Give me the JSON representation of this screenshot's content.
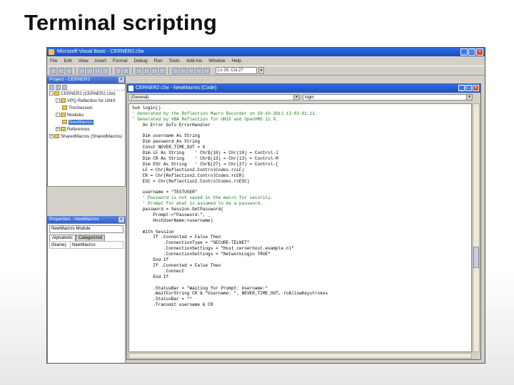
{
  "slide": {
    "title": "Terminal scripting"
  },
  "app": {
    "title": "Microsoft Visual Basic - CERNER2.r2w",
    "menu": [
      "File",
      "Edit",
      "View",
      "Insert",
      "Format",
      "Debug",
      "Run",
      "Tools",
      "Add-Ins",
      "Window",
      "Help"
    ],
    "toolbar_position": "Ln 26, Col 27"
  },
  "project": {
    "title": "Project - CERNER2",
    "tree": [
      {
        "label": "CERNER2 (CERNER2.r2w)",
        "level": 0,
        "expander": "-"
      },
      {
        "label": "VPQ Reflection for UNIX",
        "level": 1,
        "expander": "-"
      },
      {
        "label": "ThisSession",
        "level": 2,
        "expander": ""
      },
      {
        "label": "Modules",
        "level": 1,
        "expander": "-"
      },
      {
        "label": "NewMacros",
        "level": 2,
        "expander": "",
        "selected": true
      },
      {
        "label": "References",
        "level": 1,
        "expander": "+"
      },
      {
        "label": "SharedMacros (SharedMacros)",
        "level": 0,
        "expander": "+"
      }
    ]
  },
  "properties": {
    "title": "Properties - NewMacros",
    "selector": "NewMacros Module",
    "tabs": [
      "Alphabetic",
      "Categorized"
    ],
    "rows": [
      {
        "key": "(Name)",
        "value": "NewMacros"
      }
    ]
  },
  "code_window": {
    "title": "CERNER2.r2w - NewMacros (Code)",
    "object_combo": "(General)",
    "proc_combo": "login",
    "lines": [
      {
        "text": "Sub login()",
        "comment": false
      },
      {
        "text": "' Generated by the Reflection Macro Recorder on 19-10-2011 13:03:01.11.",
        "comment": true
      },
      {
        "text": "' Generated by VBA Reflection for UNIX and OpenVMS 12.0.",
        "comment": true
      },
      {
        "text": "    On Error GoTo ErrorHandler",
        "comment": false
      },
      {
        "text": "",
        "comment": false
      },
      {
        "text": "    Dim username As String",
        "comment": false
      },
      {
        "text": "    Dim password As String",
        "comment": false
      },
      {
        "text": "    Const NEVER_TIME_OUT = 0",
        "comment": false
      },
      {
        "text": "    Dim LF As String    ' Chr$(10) = Chr(10) = Control-J",
        "comment": false
      },
      {
        "text": "    Dim CR As String    ' Chr$(13) = Chr(13) = Control-M",
        "comment": false
      },
      {
        "text": "    Dim ESC As String   ' Chr$(27) = Chr(27) = Control-[",
        "comment": false
      },
      {
        "text": "    LF = Chr(Reflection2.ControlCodes.rcLF)",
        "comment": false
      },
      {
        "text": "    CR = Chr(Reflection2.ControlCodes.rcCR)",
        "comment": false
      },
      {
        "text": "    ESC = Chr(Reflection2.ControlCodes.rcESC)",
        "comment": false
      },
      {
        "text": "",
        "comment": false
      },
      {
        "text": "    username = \"TESTUSER\"",
        "comment": false
      },
      {
        "text": "    ' Password is not saved in the macro for security.",
        "comment": true
      },
      {
        "text": "    ' Prompt for what is assumed to be a password.",
        "comment": true
      },
      {
        "text": "    password = Session.GetPassword(",
        "comment": false
      },
      {
        "text": "        Prompt:=\"Password:\", _",
        "comment": false
      },
      {
        "text": "        HostUserName:=username)",
        "comment": false
      },
      {
        "text": "",
        "comment": false
      },
      {
        "text": "    With Session",
        "comment": false
      },
      {
        "text": "        If .Connected = False Then",
        "comment": false
      },
      {
        "text": "            .ConnectionType = \"SECURE-TELNET\"",
        "comment": false
      },
      {
        "text": "            .ConnectionSettings = \"Host cernerhost.example.nl\"",
        "comment": false
      },
      {
        "text": "            .ConnectionSettings = \"NetworkLogin TRUE\"",
        "comment": false
      },
      {
        "text": "        End If",
        "comment": false
      },
      {
        "text": "        If .Connected = False Then",
        "comment": false
      },
      {
        "text": "            .Connect",
        "comment": false
      },
      {
        "text": "        End If",
        "comment": false
      },
      {
        "text": "",
        "comment": false
      },
      {
        "text": "        .StatusBar = \"Waiting for Prompt: Username:\"",
        "comment": false
      },
      {
        "text": "        .WaitForString CR & \"Username: \", NEVER_TIME_OUT, rcAllowKeystrokes",
        "comment": false
      },
      {
        "text": "        .StatusBar = \"\"",
        "comment": false
      },
      {
        "text": "        .Transmit username & CR",
        "comment": false
      }
    ]
  }
}
